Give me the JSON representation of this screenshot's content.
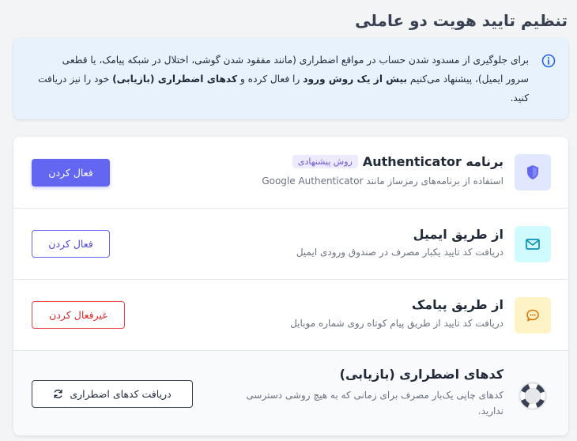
{
  "page": {
    "title": "تنظیم تایید هویت دو عاملی"
  },
  "info": {
    "text_before": "برای جلوگیری از مسدود شدن حساب در مواقع اضطراری (مانند مفقود شدن گوشی، اختلال در شبکه پیامک، یا قطعی سرور ایمیل)، پیشنهاد می‌کنیم ",
    "bold_1": "بیش از یک روش ورود",
    "text_middle": " را فعال کرده و ",
    "bold_2": "کدهای اضطراری (بازیابی)",
    "text_after": " خود را نیز دریافت کنید.",
    "icon": "info-circle-icon"
  },
  "methods": [
    {
      "title": "برنامه Authenticator",
      "badge": "روش پیشنهادی",
      "description": "استفاده از برنامه‌های رمزساز مانند Google Authenticator",
      "button": "فعال کردن",
      "icon": "shield-icon",
      "icon_bg": "#e0e7ff",
      "icon_color": "#6366f1"
    },
    {
      "title": "از طریق ایمیل",
      "description": "دریافت کد تایید یکبار مصرف در صندوق ورودی ایمیل",
      "button": "فعال کردن",
      "icon": "mail-icon",
      "icon_bg": "#cffafe",
      "icon_color": "#0891b2"
    },
    {
      "title": "از طریق پیامک",
      "description": "دریافت کد تایید از طریق پیام کوتاه روی شماره موبایل",
      "button": "غیرفعال کردن",
      "icon": "chat-bubble-icon",
      "icon_bg": "#fef3c7",
      "icon_color": "#d97706"
    },
    {
      "title": "کدهای اضطراری (بازیابی)",
      "description_line1": "کدهای چاپی یک‌بار مصرف برای زمانی که به هیچ روشی دسترسی",
      "description_line2": "ندارید.",
      "button": "دریافت کدهای اضطراری",
      "icon": "life-ring-icon",
      "button_icon": "refresh-icon"
    }
  ],
  "colors": {
    "accent": "#6366f1",
    "danger": "#ef4444",
    "info_bg": "#e8f2fd"
  }
}
